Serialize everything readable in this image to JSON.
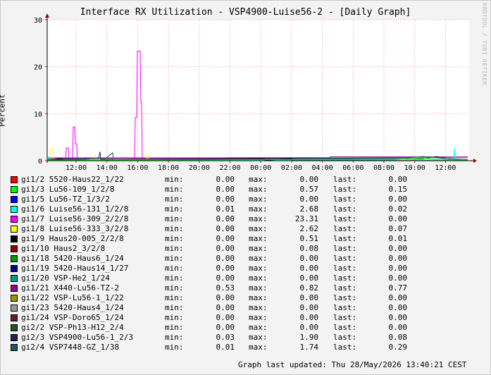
{
  "title": "Interface RX Utilization - VSP4900-Luise56-2 - [Daily Graph]",
  "watermark": "RRDTOOL / TOBI OETIKER",
  "last_updated": "Graph last updated: Thu 28/May/2026 13:40:21 CEST",
  "labels": {
    "min": "min:",
    "max": "max:",
    "last": "last:"
  },
  "chart_data": {
    "type": "line",
    "ylabel": "Percent",
    "ylim": [
      0,
      30
    ],
    "yticks": [
      "0",
      "10",
      "20",
      "30"
    ],
    "xticks": [
      "12:00",
      "14:00",
      "16:00",
      "18:00",
      "20:00",
      "22:00",
      "00:00",
      "02:00",
      "04:00",
      "06:00",
      "08:00",
      "10:00",
      "12:00"
    ],
    "series": [
      {
        "name": "gi1/2 5520-Haus22_1/22",
        "color": "#ff0000",
        "min": "0.00",
        "max": "0.00",
        "last": "0.00"
      },
      {
        "name": "gi1/3 Lu56-109_1/2/8",
        "color": "#00ff00",
        "min": "0.00",
        "max": "0.57",
        "last": "0.15"
      },
      {
        "name": "gi1/5 Lu56-TZ_1/3/2",
        "color": "#0000ff",
        "min": "0.00",
        "max": "0.00",
        "last": "0.00"
      },
      {
        "name": "gi1/6 Luise56-131_1/2/8",
        "color": "#00ffff",
        "min": "0.01",
        "max": "2.68",
        "last": "0.02"
      },
      {
        "name": "gi1/7 Luise56-309_2/2/8",
        "color": "#ff00ff",
        "min": "0.00",
        "max": "23.31",
        "last": "0.00"
      },
      {
        "name": "gi1/8 Luise56-333_3/2/8",
        "color": "#ffff00",
        "min": "0.00",
        "max": "2.62",
        "last": "0.07"
      },
      {
        "name": "gi1/9 Haus20-005_2/2/8",
        "color": "#000000",
        "min": "0.00",
        "max": "0.51",
        "last": "0.01"
      },
      {
        "name": "gi1/10 Haus2_3/2/8",
        "color": "#990000",
        "min": "0.00",
        "max": "0.08",
        "last": "0.00"
      },
      {
        "name": "gi1/18 5420-Haus6_1/24",
        "color": "#009900",
        "min": "0.00",
        "max": "0.00",
        "last": "0.00"
      },
      {
        "name": "gi1/19 5420-Haus14_1/27",
        "color": "#000099",
        "min": "0.00",
        "max": "0.00",
        "last": "0.00"
      },
      {
        "name": "gi1/20 VSP-He2_1/24",
        "color": "#009999",
        "min": "0.00",
        "max": "0.00",
        "last": "0.00"
      },
      {
        "name": "gi1/21 X440-Lu56-TZ-2",
        "color": "#990099",
        "min": "0.53",
        "max": "0.82",
        "last": "0.77"
      },
      {
        "name": "gi1/22 VSP-Lu56-1_1/22",
        "color": "#999900",
        "min": "0.00",
        "max": "0.00",
        "last": "0.00"
      },
      {
        "name": "gi1/23 5420-Haus4_1/24",
        "color": "#999999",
        "min": "0.00",
        "max": "0.00",
        "last": "0.00"
      },
      {
        "name": "gi1/24 VSP-Doro65_1/24",
        "color": "#662222",
        "min": "0.00",
        "max": "0.00",
        "last": "0.00"
      },
      {
        "name": "gi2/2 VSP-Ph13-H12_2/4",
        "color": "#225522",
        "min": "0.00",
        "max": "0.00",
        "last": "0.00"
      },
      {
        "name": "gi2/3 VSP4900-Lu56-1_2/3",
        "color": "#222255",
        "min": "0.03",
        "max": "1.90",
        "last": "0.08"
      },
      {
        "name": "gi2/4 VSP7448-GZ_1/38",
        "color": "#225566",
        "min": "0.01",
        "max": "1.74",
        "last": "0.29"
      }
    ]
  }
}
